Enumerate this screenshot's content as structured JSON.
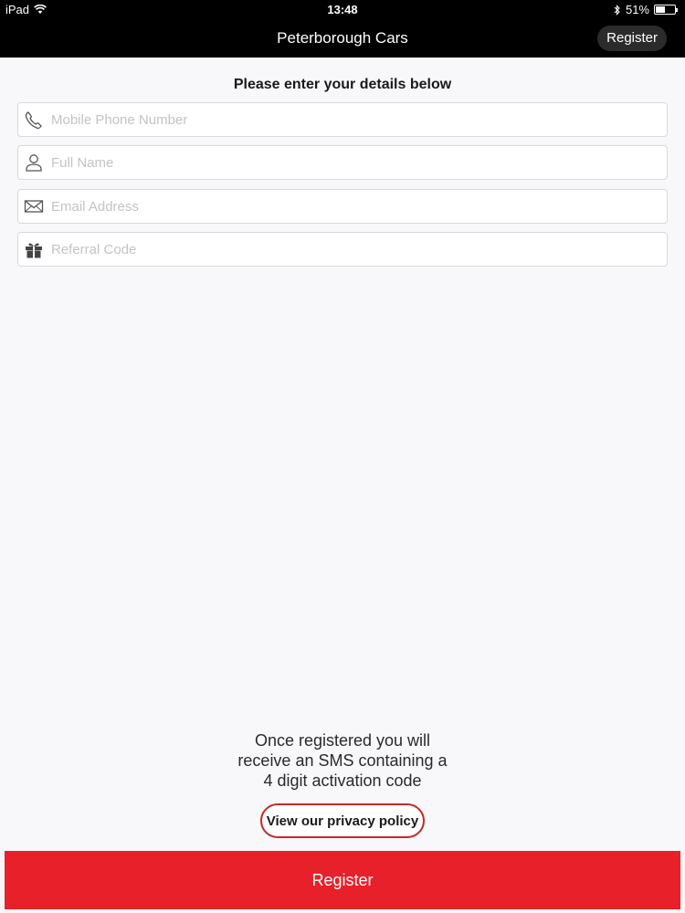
{
  "status_bar": {
    "device": "iPad",
    "time": "13:48",
    "battery_text": "51%",
    "battery_level": 0.51
  },
  "nav": {
    "title": "Peterborough Cars",
    "register_label": "Register"
  },
  "form": {
    "heading": "Please enter your details below",
    "fields": [
      {
        "placeholder": "Mobile Phone Number",
        "icon": "phone-icon"
      },
      {
        "placeholder": "Full Name",
        "icon": "user-icon"
      },
      {
        "placeholder": "Email Address",
        "icon": "envelope-icon"
      },
      {
        "placeholder": "Referral Code",
        "icon": "gift-icon"
      }
    ]
  },
  "info": {
    "lines": [
      "Once registered you will",
      "receive an SMS containing a",
      "4 digit activation code"
    ]
  },
  "privacy_label": "View our privacy policy",
  "register_button_label": "Register",
  "colors": {
    "accent_red": "#e8202a",
    "nav_bg": "#000000"
  }
}
